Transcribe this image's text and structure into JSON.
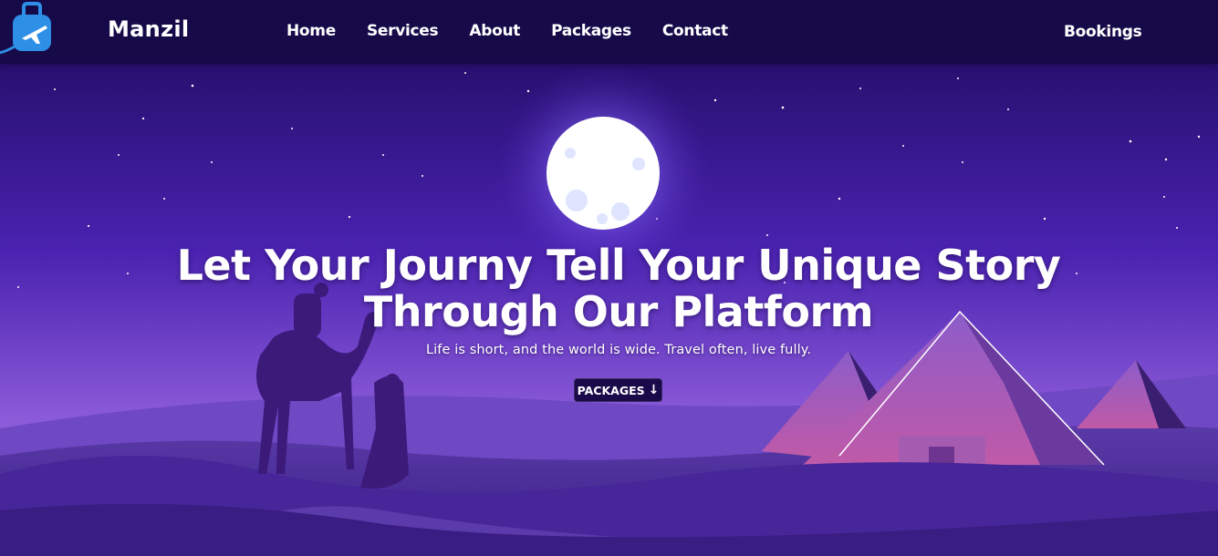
{
  "brand": {
    "name": "Manzil",
    "logo_icon": "suitcase-plane-icon"
  },
  "nav": {
    "items": [
      {
        "label": "Home"
      },
      {
        "label": "Services"
      },
      {
        "label": "About"
      },
      {
        "label": "Packages"
      },
      {
        "label": "Contact"
      }
    ],
    "bookings_label": "Bookings"
  },
  "hero": {
    "title_line1": "Let Your Journy Tell Your Unique Story",
    "title_line2": "Through Our Platform",
    "subtitle": "Life is short, and the world is wide. Travel often, live fully.",
    "cta_label": "PACKAGES",
    "cta_icon": "arrow-down-icon"
  },
  "colors": {
    "nav_bg": "#160a46",
    "sky_top": "#1d0b5c",
    "sky_bottom": "#7b4fd6",
    "moon": "#ffffff",
    "pyramid": "#b15fb8",
    "cta_bg": "#1a0a4a"
  }
}
